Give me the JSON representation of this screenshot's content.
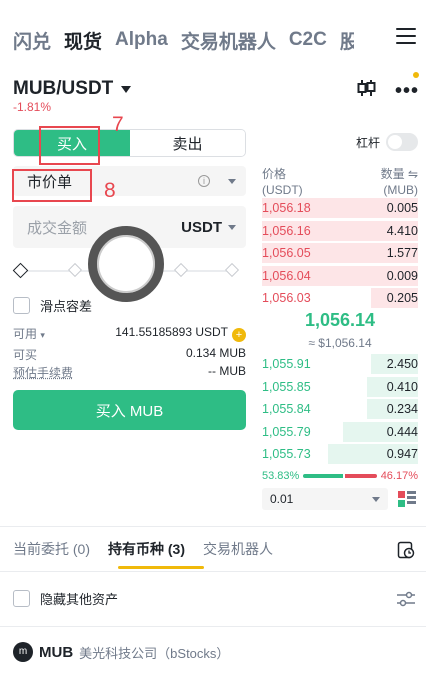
{
  "top_tabs": [
    {
      "label": "闪兑",
      "active": false
    },
    {
      "label": "现货",
      "active": true
    },
    {
      "label": "Alpha",
      "active": false
    },
    {
      "label": "交易机器人",
      "active": false
    },
    {
      "label": "C2C",
      "active": false
    },
    {
      "label": "股",
      "active": false
    }
  ],
  "pair": {
    "name": "MUB/USDT",
    "change": "-1.81%"
  },
  "trade": {
    "buy_tab": "买入",
    "sell_tab": "卖出",
    "leverage_label": "杠杆",
    "order_type": "市价单",
    "info_glyph": "i",
    "amount_placeholder": "成交金额",
    "amount_unit": "USDT",
    "slippage_label": "滑点容差",
    "available_label": "可用",
    "available_value": "141.55185893 USDT",
    "can_buy_label": "可买",
    "can_buy_value": "0.134 MUB",
    "fee_label": "预估手续费",
    "fee_value": "-- MUB",
    "buy_button": "买入 MUB"
  },
  "orderbook": {
    "price_header": "价格",
    "price_unit": "(USDT)",
    "qty_header": "数量",
    "qty_unit": "(MUB)",
    "asks": [
      {
        "price": "1,056.18",
        "qty": "0.005",
        "depth": 1.0
      },
      {
        "price": "1,056.16",
        "qty": "4.410",
        "depth": 1.0
      },
      {
        "price": "1,056.05",
        "qty": "1.577",
        "depth": 1.0
      },
      {
        "price": "1,056.04",
        "qty": "0.009",
        "depth": 1.0
      },
      {
        "price": "1,056.03",
        "qty": "0.205",
        "depth": 0.3
      }
    ],
    "mid_price": "1,056.14",
    "mid_usd": "≈ $1,056.14",
    "bids": [
      {
        "price": "1,055.91",
        "qty": "2.450",
        "depth": 0.3
      },
      {
        "price": "1,055.85",
        "qty": "0.410",
        "depth": 0.33
      },
      {
        "price": "1,055.84",
        "qty": "0.234",
        "depth": 0.33
      },
      {
        "price": "1,055.79",
        "qty": "0.444",
        "depth": 0.48
      },
      {
        "price": "1,055.73",
        "qty": "0.947",
        "depth": 0.58
      }
    ],
    "buy_ratio": "53.83%",
    "sell_ratio": "46.17%",
    "precision": "0.01"
  },
  "bottom_tabs": [
    {
      "label": "当前委托 (0)",
      "active": false
    },
    {
      "label": "持有币种 (3)",
      "active": true
    },
    {
      "label": "交易机器人",
      "active": false
    }
  ],
  "hide_assets_label": "隐藏其他资产",
  "asset": {
    "symbol": "MUB",
    "name": "美光科技公司（bStocks）",
    "logo_text": "m"
  },
  "annotations": {
    "n7": "7",
    "n8": "8"
  },
  "colors": {
    "green": "#2ebd85",
    "red": "#e44c5a",
    "accent": "#f0b90b",
    "annotation": "#e8474f"
  }
}
